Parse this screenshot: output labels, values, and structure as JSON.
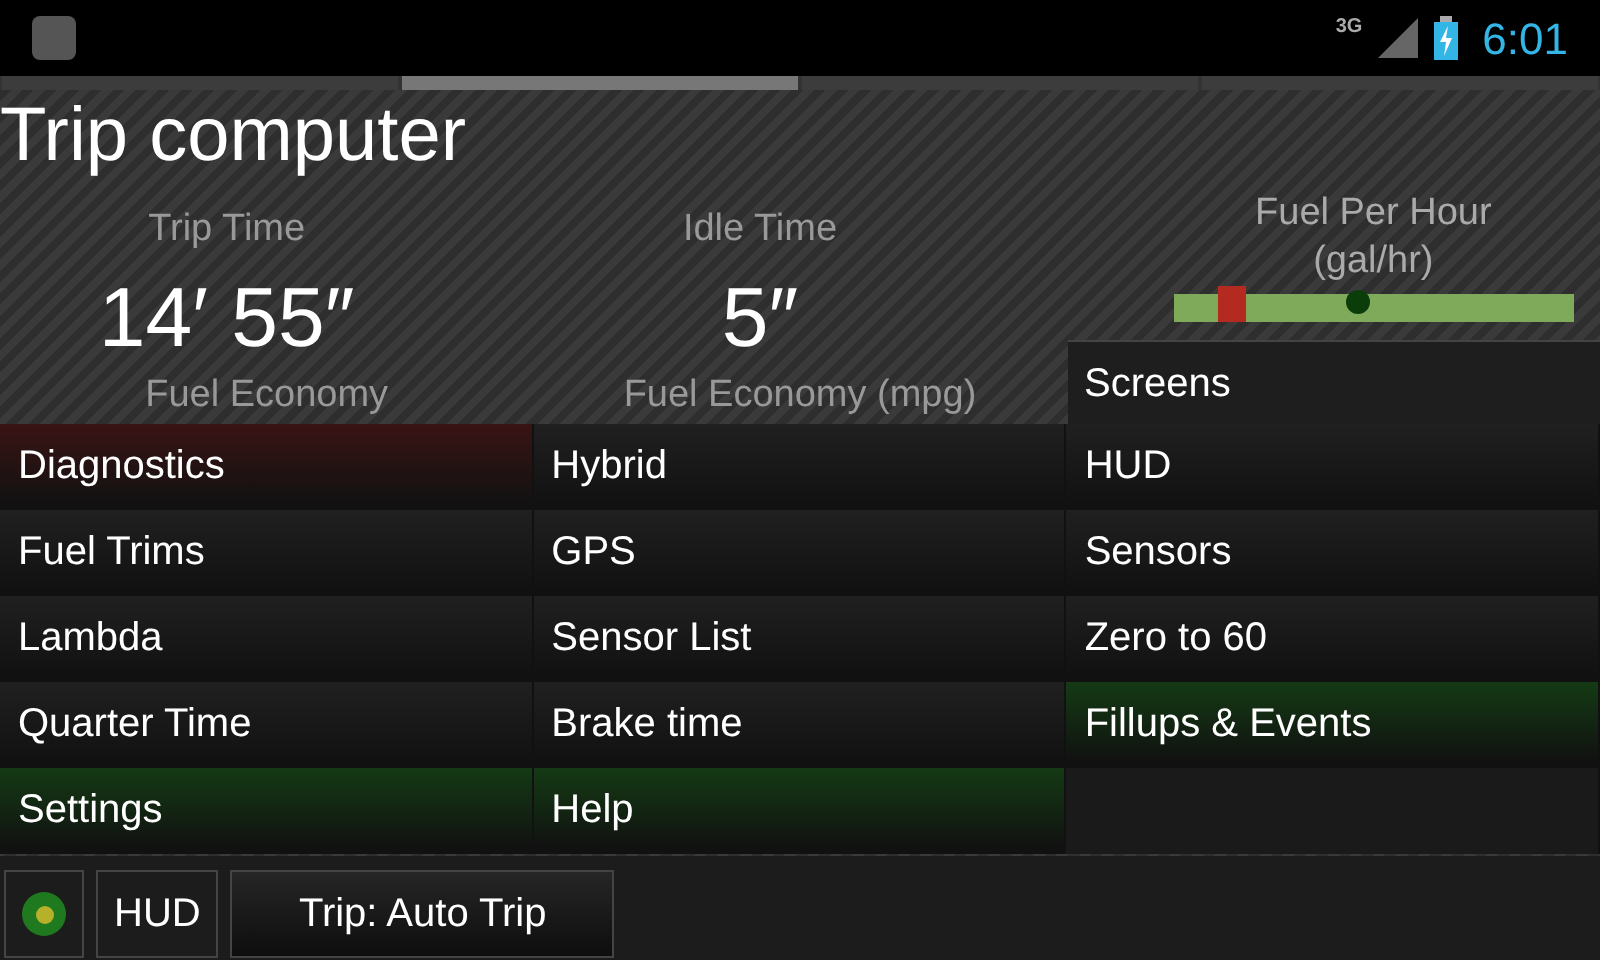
{
  "status_bar": {
    "network": "3G",
    "time": "6:01"
  },
  "page_indicator": [
    {
      "selected": false
    },
    {
      "selected": true
    },
    {
      "selected": false
    },
    {
      "selected": false
    }
  ],
  "title": "Trip computer",
  "gauges": [
    {
      "kind": "value",
      "label": "Trip Time",
      "value": "14′ 55″"
    },
    {
      "kind": "value",
      "label": "Idle Time",
      "value": "5″"
    },
    {
      "kind": "graph",
      "label": "Fuel Per Hour (gal/hr)"
    }
  ],
  "lower_gauges": [
    {
      "label": "Fuel Economy"
    },
    {
      "label": "Fuel Economy (mpg)"
    }
  ],
  "menu": {
    "header": "Screens",
    "columns": [
      [
        {
          "label": "Diagnostics",
          "color": "#3a1414"
        },
        {
          "label": "Fuel Trims",
          "color": "#202020"
        },
        {
          "label": "Lambda",
          "color": "#202020"
        },
        {
          "label": "Quarter Time",
          "color": "#202020"
        },
        {
          "label": "Settings",
          "color": "#143a14"
        }
      ],
      [
        {
          "label": "Hybrid",
          "color": "#202020"
        },
        {
          "label": "GPS",
          "color": "#202020"
        },
        {
          "label": "Sensor List",
          "color": "#202020"
        },
        {
          "label": "Brake time",
          "color": "#202020"
        },
        {
          "label": "Help",
          "color": "#143a14"
        }
      ],
      [
        {
          "label": "HUD",
          "color": "#202020"
        },
        {
          "label": "Sensors",
          "color": "#202020"
        },
        {
          "label": "Zero to 60",
          "color": "#202020"
        },
        {
          "label": "Fillups & Events",
          "color": "#143a14"
        }
      ]
    ]
  },
  "bottom_bar": {
    "hud_button": "HUD",
    "trip_button": "Trip: Auto Trip"
  }
}
